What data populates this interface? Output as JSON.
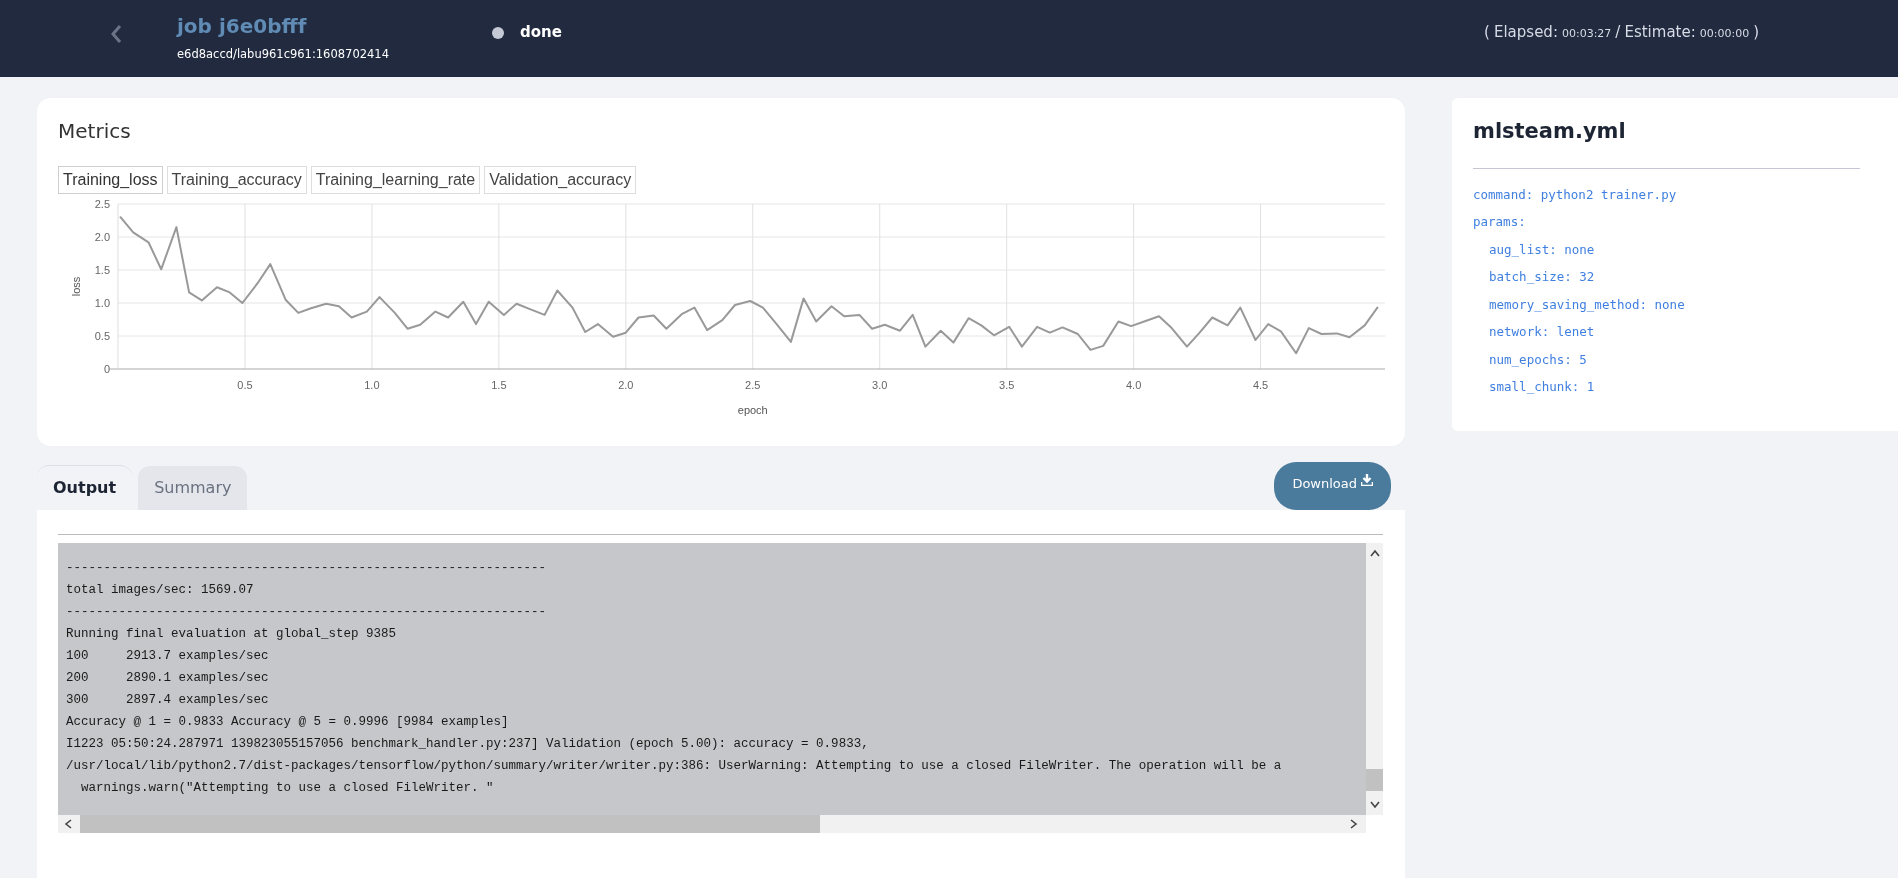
{
  "header": {
    "title": "job j6e0bfff",
    "subtitle": "e6d8accd/labu961c961:1608702414",
    "status": "done",
    "timing": {
      "open": "(",
      "items": [
        {
          "label": "Elapsed:",
          "value": "00:03:27"
        },
        {
          "label": "Estimate:",
          "value": "00:00:00"
        }
      ],
      "separator": "/",
      "close": ")"
    }
  },
  "metrics": {
    "title": "Metrics",
    "tabs": [
      {
        "label": "Training_loss",
        "selected": true
      },
      {
        "label": "Training_accuracy",
        "selected": false
      },
      {
        "label": "Training_learning_rate",
        "selected": false
      },
      {
        "label": "Validation_accuracy",
        "selected": false
      }
    ],
    "chart_data": {
      "type": "line",
      "xlabel": "epoch",
      "ylabel": "loss",
      "x": [
        0.01,
        0.06,
        0.12,
        0.17,
        0.23,
        0.28,
        0.33,
        0.39,
        0.44,
        0.49,
        0.55,
        0.6,
        0.66,
        0.71,
        0.76,
        0.82,
        0.87,
        0.92,
        0.98,
        1.03,
        1.09,
        1.14,
        1.19,
        1.25,
        1.3,
        1.36,
        1.41,
        1.46,
        1.52,
        1.57,
        1.62,
        1.68,
        1.73,
        1.79,
        1.84,
        1.89,
        1.95,
        2.0,
        2.05,
        2.11,
        2.16,
        2.22,
        2.27,
        2.32,
        2.38,
        2.43,
        2.49,
        2.54,
        2.59,
        2.65,
        2.7,
        2.75,
        2.81,
        2.86,
        2.92,
        2.97,
        3.02,
        3.08,
        3.13,
        3.18,
        3.24,
        3.29,
        3.35,
        3.4,
        3.45,
        3.51,
        3.56,
        3.62,
        3.67,
        3.72,
        3.78,
        3.83,
        3.88,
        3.94,
        3.99,
        4.05,
        4.1,
        4.15,
        4.21,
        4.26,
        4.31,
        4.37,
        4.42,
        4.48,
        4.53,
        4.58,
        4.64,
        4.69,
        4.74,
        4.8,
        4.85,
        4.91,
        4.96
      ],
      "series": [
        {
          "color": "#999999",
          "values": [
            2.3,
            2.07,
            1.92,
            1.51,
            2.15,
            1.16,
            1.04,
            1.24,
            1.16,
            1.0,
            1.3,
            1.59,
            1.05,
            0.85,
            0.92,
            0.99,
            0.95,
            0.78,
            0.87,
            1.09,
            0.85,
            0.61,
            0.67,
            0.87,
            0.78,
            1.02,
            0.68,
            1.02,
            0.82,
            0.99,
            0.91,
            0.82,
            1.19,
            0.93,
            0.56,
            0.68,
            0.49,
            0.55,
            0.78,
            0.81,
            0.61,
            0.83,
            0.93,
            0.59,
            0.74,
            0.97,
            1.03,
            0.93,
            0.7,
            0.41,
            1.07,
            0.72,
            0.95,
            0.8,
            0.82,
            0.61,
            0.67,
            0.58,
            0.82,
            0.34,
            0.58,
            0.4,
            0.77,
            0.66,
            0.51,
            0.64,
            0.34,
            0.64,
            0.55,
            0.63,
            0.53,
            0.29,
            0.35,
            0.72,
            0.65,
            0.73,
            0.8,
            0.62,
            0.34,
            0.55,
            0.78,
            0.66,
            0.93,
            0.44,
            0.68,
            0.57,
            0.24,
            0.62,
            0.53,
            0.54,
            0.48,
            0.66,
            0.93
          ]
        }
      ],
      "grid": true,
      "xlim": [
        0,
        4.99
      ],
      "ylim": [
        0,
        2.5
      ],
      "xticks": [
        {
          "value": 0.5,
          "label": "0.5"
        },
        {
          "value": 1,
          "label": "1.0"
        },
        {
          "value": 1.5,
          "label": "1.5"
        },
        {
          "value": 2,
          "label": "2.0"
        },
        {
          "value": 2.5,
          "label": "2.5"
        },
        {
          "value": 3,
          "label": "3.0"
        },
        {
          "value": 3.5,
          "label": "3.5"
        },
        {
          "value": 4,
          "label": "4.0"
        },
        {
          "value": 4.5,
          "label": "4.5"
        }
      ],
      "yticks": [
        {
          "value": 0,
          "label": "0"
        },
        {
          "value": 0.5,
          "label": "0.5"
        },
        {
          "value": 1,
          "label": "1.0"
        },
        {
          "value": 1.5,
          "label": "1.5"
        },
        {
          "value": 2,
          "label": "2.0"
        },
        {
          "value": 2.5,
          "label": "2.5"
        }
      ]
    }
  },
  "config": {
    "title": "mlsteam.yml",
    "lines": [
      {
        "text": "command: python2 trainer.py"
      },
      {
        "text": "params:",
        "children": [
          {
            "text": "aug_list: none"
          },
          {
            "text": "batch_size: 32"
          },
          {
            "text": "memory_saving_method: none"
          },
          {
            "text": "network: lenet"
          },
          {
            "text": "num_epochs: 5"
          },
          {
            "text": "small_chunk: 1"
          }
        ]
      }
    ]
  },
  "output": {
    "tabs": [
      {
        "label": "Output",
        "selected": true
      },
      {
        "label": "Summary",
        "selected": false
      }
    ],
    "download": "Download",
    "log_lines": [
      "----------------------------------------------------------------",
      "total images/sec: 1569.07",
      "----------------------------------------------------------------",
      "Running final evaluation at global_step 9385",
      "100     2913.7 examples/sec",
      "200     2890.1 examples/sec",
      "300     2897.4 examples/sec",
      "Accuracy @ 1 = 0.9833 Accuracy @ 5 = 0.9996 [9984 examples]",
      "I1223 05:50:24.287971 139823055157056 benchmark_handler.py:237] Validation (epoch 5.00): accuracy = 0.9833,",
      "/usr/local/lib/python2.7/dist-packages/tensorflow/python/summary/writer/writer.py:386: UserWarning: Attempting to use a closed FileWriter. The operation will be a",
      "  warnings.warn(\"Attempting to use a closed FileWriter. \""
    ]
  }
}
